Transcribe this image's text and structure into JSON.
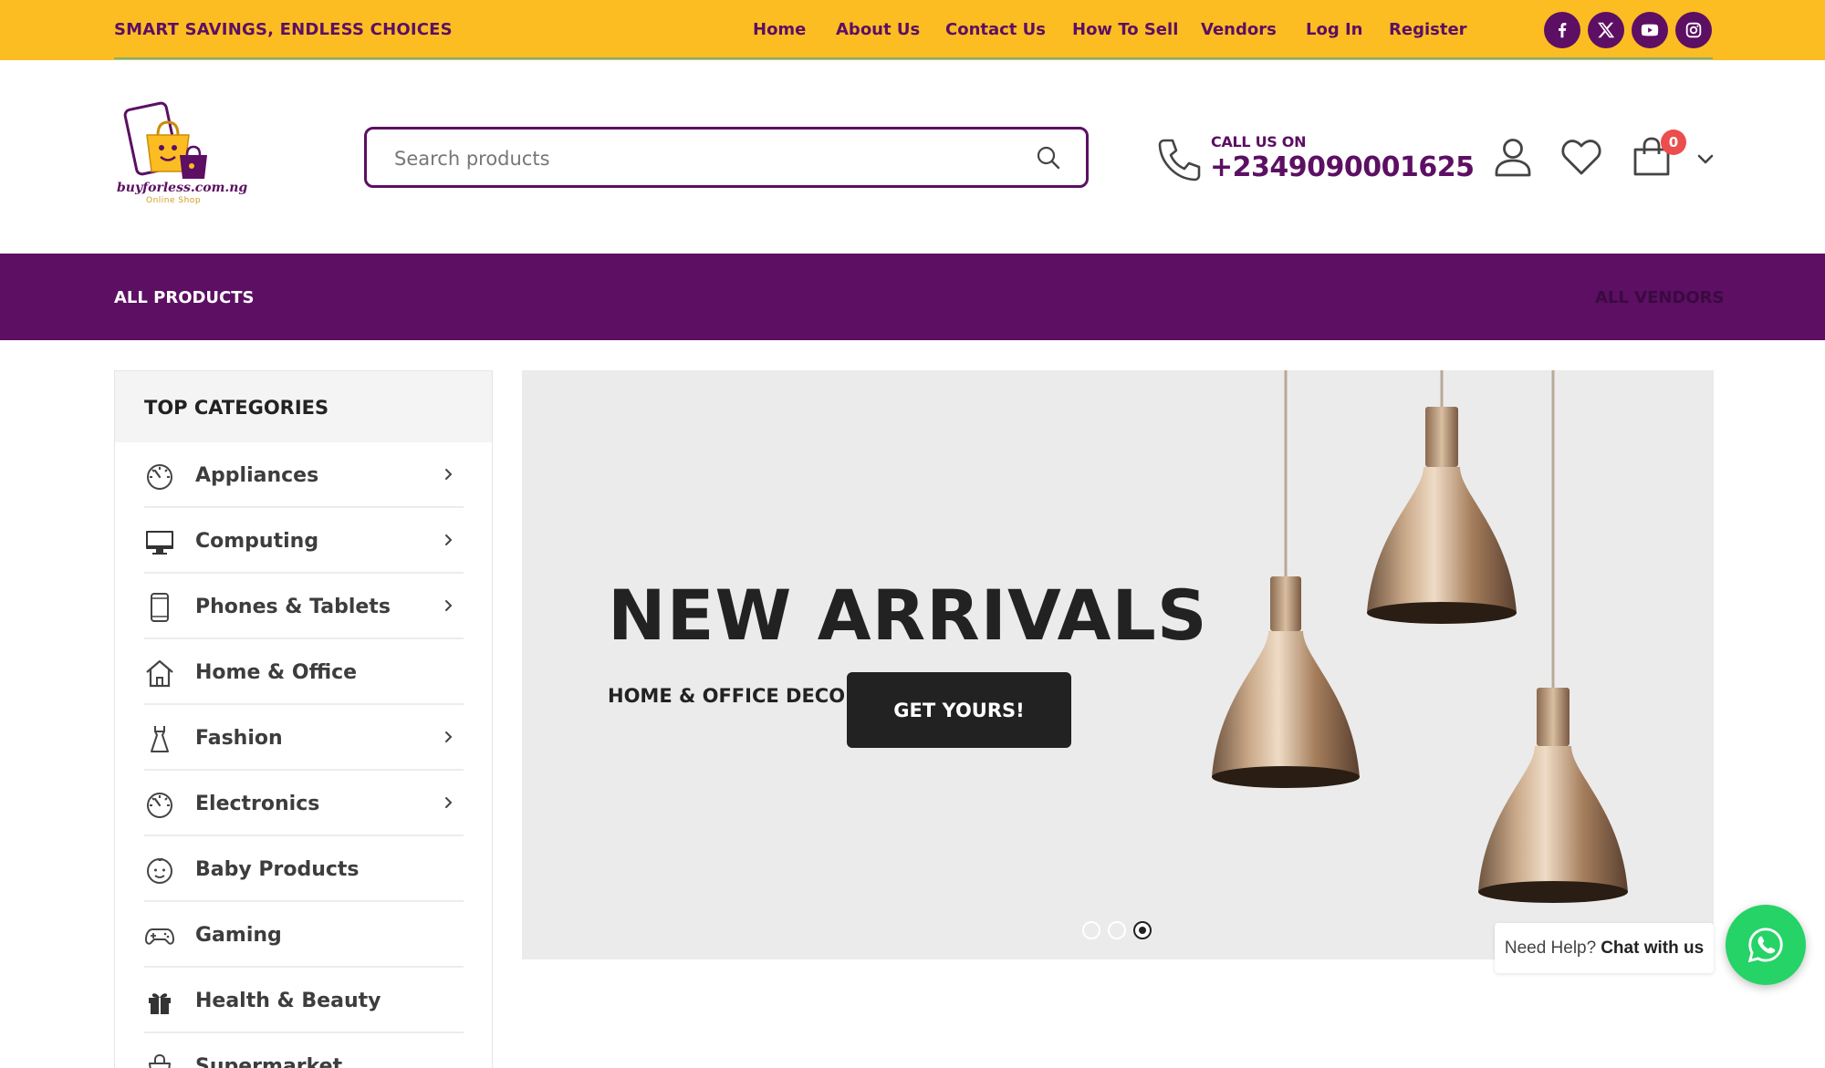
{
  "topbar": {
    "tagline": "SMART SAVINGS, ENDLESS CHOICES",
    "nav": [
      "Home",
      "About Us",
      "Contact Us",
      "How To Sell",
      "Vendors",
      "Log In",
      "Register"
    ],
    "social": [
      "facebook-icon",
      "x-twitter-icon",
      "youtube-icon",
      "instagram-icon"
    ]
  },
  "header": {
    "logo_text": "buyforless.com.ng",
    "logo_sub": "Online Shop",
    "search_placeholder": "Search products",
    "call_label": "CALL US ON",
    "call_number": "+2349090001625",
    "cart_count": "0"
  },
  "navbar": {
    "all_products": "ALL PRODUCTS",
    "all_vendors": "ALL VENDORS"
  },
  "sidebar": {
    "title": "TOP CATEGORIES",
    "categories": [
      {
        "label": "Appliances",
        "icon": "gauge-icon",
        "has_sub": true
      },
      {
        "label": "Computing",
        "icon": "monitor-icon",
        "has_sub": true
      },
      {
        "label": "Phones & Tablets",
        "icon": "phone-device-icon",
        "has_sub": true
      },
      {
        "label": "Home & Office",
        "icon": "house-icon",
        "has_sub": false
      },
      {
        "label": "Fashion",
        "icon": "dress-icon",
        "has_sub": true
      },
      {
        "label": "Electronics",
        "icon": "gauge-icon",
        "has_sub": true
      },
      {
        "label": "Baby Products",
        "icon": "baby-icon",
        "has_sub": false
      },
      {
        "label": "Gaming",
        "icon": "gamepad-icon",
        "has_sub": false
      },
      {
        "label": "Health & Beauty",
        "icon": "gift-icon",
        "has_sub": false
      },
      {
        "label": "Supermarket",
        "icon": "basket-icon",
        "has_sub": false
      }
    ]
  },
  "banner": {
    "title": "NEW ARRIVALS",
    "subtitle": "HOME & OFFICE DECOR",
    "cta": "GET YOURS!",
    "slides": 3,
    "active_slide": 3
  },
  "help": {
    "text": "Need Help?",
    "link": "Chat with us"
  },
  "colors": {
    "topbar": "#fcbd22",
    "brand_purple": "#5c0f63",
    "whatsapp": "#25d366",
    "badge": "#ec4d4d"
  }
}
